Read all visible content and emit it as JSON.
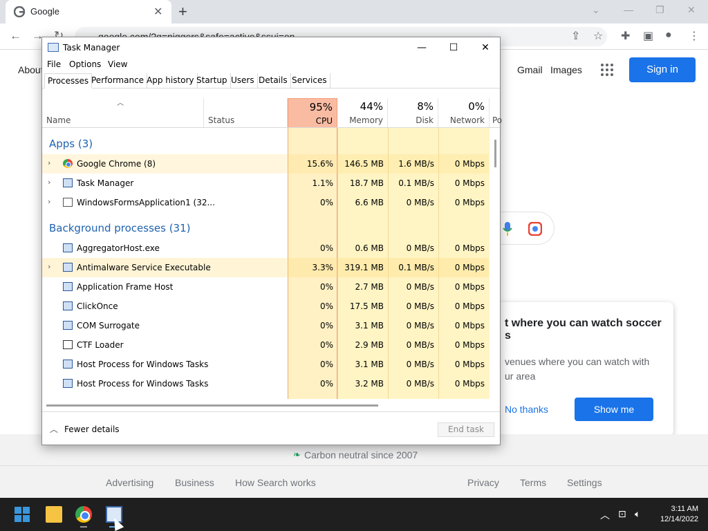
{
  "browser": {
    "tab_title": "Google",
    "url": "google.com/?q=niggers&safe=active&ssui=on"
  },
  "google": {
    "about": "About",
    "gmail": "Gmail",
    "images": "Images",
    "sign_in": "Sign in",
    "popup": {
      "heading": "Find where you can watch soccer",
      "heading_visible": "t where you can watch soccer",
      "heading_line2": "s",
      "body": "venues where you can watch with",
      "body_line2": "ur area",
      "no_thanks": "No thanks",
      "show_me": "Show me"
    },
    "footer": {
      "carbon": "Carbon neutral since 2007",
      "links_left": [
        "Advertising",
        "Business",
        "How Search works"
      ],
      "links_right": [
        "Privacy",
        "Terms",
        "Settings"
      ]
    }
  },
  "task_manager": {
    "title": "Task Manager",
    "menu": [
      "File",
      "Options",
      "View"
    ],
    "tabs": [
      "Processes",
      "Performance",
      "App history",
      "Startup",
      "Users",
      "Details",
      "Services"
    ],
    "columns": {
      "name": "Name",
      "status": "Status",
      "cpu": {
        "pct": "95%",
        "label": "CPU"
      },
      "memory": {
        "pct": "44%",
        "label": "Memory"
      },
      "disk": {
        "pct": "8%",
        "label": "Disk"
      },
      "network": {
        "pct": "0%",
        "label": "Network"
      },
      "power": "Po"
    },
    "groups": {
      "apps": "Apps (3)",
      "background": "Background processes (31)"
    },
    "apps": [
      {
        "name": "Google Chrome (8)",
        "cpu": "15.6%",
        "memory": "146.5 MB",
        "disk": "1.6 MB/s",
        "network": "0 Mbps"
      },
      {
        "name": "Task Manager",
        "cpu": "1.1%",
        "memory": "18.7 MB",
        "disk": "0.1 MB/s",
        "network": "0 Mbps"
      },
      {
        "name": "WindowsFormsApplication1 (32...",
        "cpu": "0%",
        "memory": "6.6 MB",
        "disk": "0 MB/s",
        "network": "0 Mbps"
      }
    ],
    "background": [
      {
        "name": "AggregatorHost.exe",
        "cpu": "0%",
        "memory": "0.6 MB",
        "disk": "0 MB/s",
        "network": "0 Mbps"
      },
      {
        "name": "Antimalware Service Executable",
        "cpu": "3.3%",
        "memory": "319.1 MB",
        "disk": "0.1 MB/s",
        "network": "0 Mbps"
      },
      {
        "name": "Application Frame Host",
        "cpu": "0%",
        "memory": "2.7 MB",
        "disk": "0 MB/s",
        "network": "0 Mbps"
      },
      {
        "name": "ClickOnce",
        "cpu": "0%",
        "memory": "17.5 MB",
        "disk": "0 MB/s",
        "network": "0 Mbps"
      },
      {
        "name": "COM Surrogate",
        "cpu": "0%",
        "memory": "3.1 MB",
        "disk": "0 MB/s",
        "network": "0 Mbps"
      },
      {
        "name": "CTF Loader",
        "cpu": "0%",
        "memory": "2.9 MB",
        "disk": "0 MB/s",
        "network": "0 Mbps"
      },
      {
        "name": "Host Process for Windows Tasks",
        "cpu": "0%",
        "memory": "3.1 MB",
        "disk": "0 MB/s",
        "network": "0 Mbps"
      },
      {
        "name": "Host Process for Windows Tasks",
        "cpu": "0%",
        "memory": "3.2 MB",
        "disk": "0 MB/s",
        "network": "0 Mbps"
      }
    ],
    "fewer_details": "Fewer details",
    "end_task": "End task"
  },
  "taskbar": {
    "time": "3:11 AM",
    "date": "12/14/2022"
  }
}
